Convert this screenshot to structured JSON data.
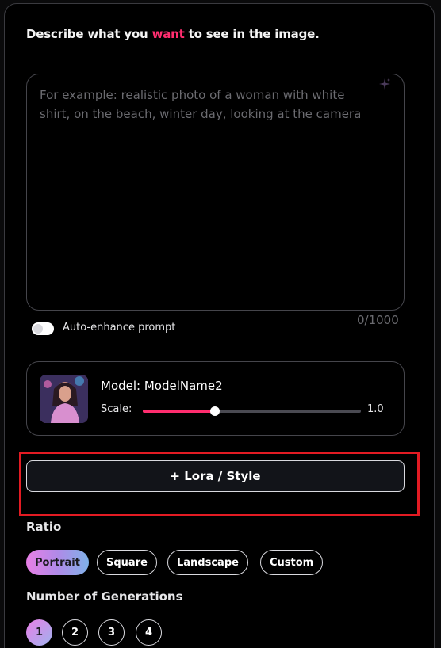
{
  "prompt": {
    "heading_before": "Describe what you ",
    "heading_accent": "want",
    "heading_after": " to see in the image.",
    "placeholder": "For example: realistic photo of a woman with white shirt, on the beach, winter day, looking at the camera",
    "value": "",
    "counter": "0/1000",
    "sparkle_icon": "sparkle-icon"
  },
  "auto_enhance": {
    "label": "Auto-enhance prompt",
    "enabled": false
  },
  "model": {
    "name_label": "Model: ModelName2",
    "scale_label": "Scale:",
    "scale_value": "1.0",
    "scale_fraction": 0.33
  },
  "lora_button": {
    "label": "+ Lora / Style"
  },
  "ratio": {
    "title": "Ratio",
    "options": [
      "Portrait",
      "Square",
      "Landscape",
      "Custom"
    ],
    "selected": "Portrait"
  },
  "generations": {
    "title": "Number of Generations",
    "options": [
      "1",
      "2",
      "3",
      "4"
    ],
    "selected": "1"
  },
  "colors": {
    "accent": "#ff2d6f",
    "highlight_border": "#e31b23",
    "active_gradient_start": "#e87fe6",
    "active_gradient_end": "#7fb1e8"
  }
}
